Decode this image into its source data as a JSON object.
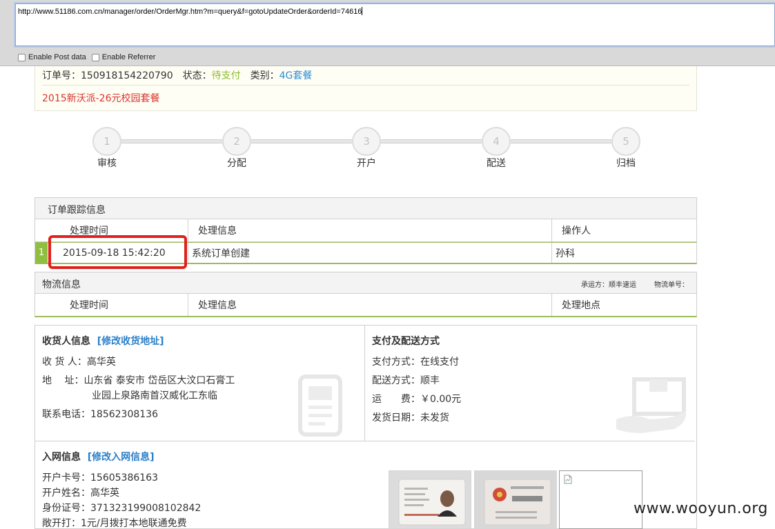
{
  "toolbar": {
    "url": "http://www.51186.com.cn/manager/order/OrderMgr.htm?m=query&f=gotoUpdateOrder&orderId=74616",
    "enable_post_label": "Enable Post data",
    "enable_referrer_label": "Enable Referrer"
  },
  "order": {
    "number_label": "订单号：",
    "number": "150918154220790",
    "status_label": "状态：",
    "status": "待支付",
    "category_label": "类别：",
    "category": "4G套餐",
    "package": "2015新沃派-26元校园套餐"
  },
  "steps": [
    {
      "num": "1",
      "label": "审核"
    },
    {
      "num": "2",
      "label": "分配"
    },
    {
      "num": "3",
      "label": "开户"
    },
    {
      "num": "4",
      "label": "配送"
    },
    {
      "num": "5",
      "label": "归档"
    }
  ],
  "tracking": {
    "title": "订单跟踪信息",
    "headers": [
      "处理时间",
      "处理信息",
      "操作人"
    ],
    "rows": [
      {
        "index": "1",
        "time": "2015-09-18 15:42:20",
        "info": "系统订单创建",
        "operator": "孙科"
      }
    ]
  },
  "logistics": {
    "title": "物流信息",
    "carrier": "承运方：顺丰速运",
    "tracking_no": "物流单号：",
    "headers": [
      "处理时间",
      "处理信息",
      "处理地点"
    ]
  },
  "receiver": {
    "title": "收货人信息",
    "edit_link": "[修改收货地址]",
    "name_label": "收 货 人：",
    "name": "高华英",
    "address_label": "地　 址：",
    "address_line1": "山东省 泰安市 岱岳区大汶口石膏工",
    "address_line2": "业园上泉路南首汉威化工东临",
    "phone_label": "联系电话：",
    "phone": "18562308136"
  },
  "payment": {
    "title": "支付及配送方式",
    "pay_label": "支付方式：",
    "pay": "在线支付",
    "ship_label": "配送方式：",
    "ship": "顺丰",
    "fee_label": "运　　费：",
    "fee": "￥0.00元",
    "date_label": "发货日期：",
    "date": "未发货"
  },
  "network": {
    "title": "入网信息",
    "edit_link": "[修改入网信息]",
    "card_label": "开户卡号：",
    "card": "15605386163",
    "name_label": "开户姓名：",
    "name": "高华英",
    "id_label": "身份证号：",
    "id": "371323199008102842",
    "plan_label": "敞开打：",
    "plan": "1元/月拨打本地联通免费"
  },
  "watermark": "www.wooyun.org"
}
